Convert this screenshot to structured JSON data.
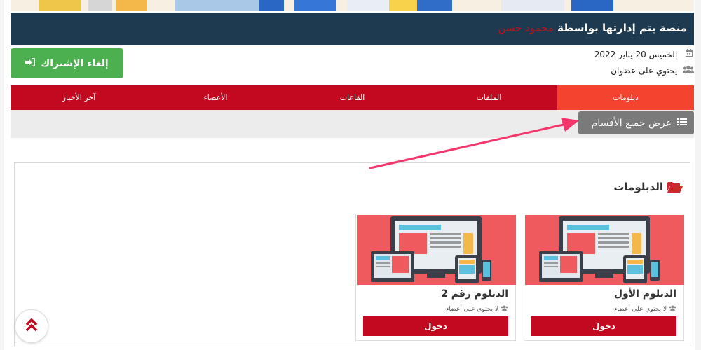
{
  "header": {
    "platform_text": "منصة يتم إدارتها بواسطة",
    "owner_name": "محمود حسن"
  },
  "meta": {
    "date": "الخميس 20 يناير 2022",
    "members": "يحتوي على عضوان"
  },
  "unsubscribe": {
    "label": "إلغاء الإشتراك"
  },
  "nav": {
    "tabs": [
      {
        "label": "دبلومات",
        "active": true
      },
      {
        "label": "الملفات",
        "active": false
      },
      {
        "label": "القاعات",
        "active": false
      },
      {
        "label": "الأعضاء",
        "active": false
      },
      {
        "label": "آخر الأخبار",
        "active": false
      }
    ]
  },
  "subbar": {
    "show_all_label": "عرض جميع الأقسام"
  },
  "section": {
    "title": "الدبلومات"
  },
  "cards": [
    {
      "title": "الدبلوم الأول",
      "members": "لا يحتوي على أعضاء",
      "enter_label": "دخول"
    },
    {
      "title": "الدبلوم رقم 2",
      "members": "لا يحتوي على أعضاء",
      "enter_label": "دخول"
    }
  ],
  "colors": {
    "header_bg": "#1d3a50",
    "nav_bg": "#c3091f",
    "nav_active": "#f4432f",
    "unsubscribe_bg": "#4caf50",
    "annotation_arrow": "#f4366c"
  },
  "icons": {
    "calendar": "calendar-icon",
    "users": "users-icon",
    "sign_out": "sign-out-icon",
    "list": "list-icon",
    "folder": "folder-open-icon",
    "scroll_top": "double-chevron-up-icon"
  }
}
